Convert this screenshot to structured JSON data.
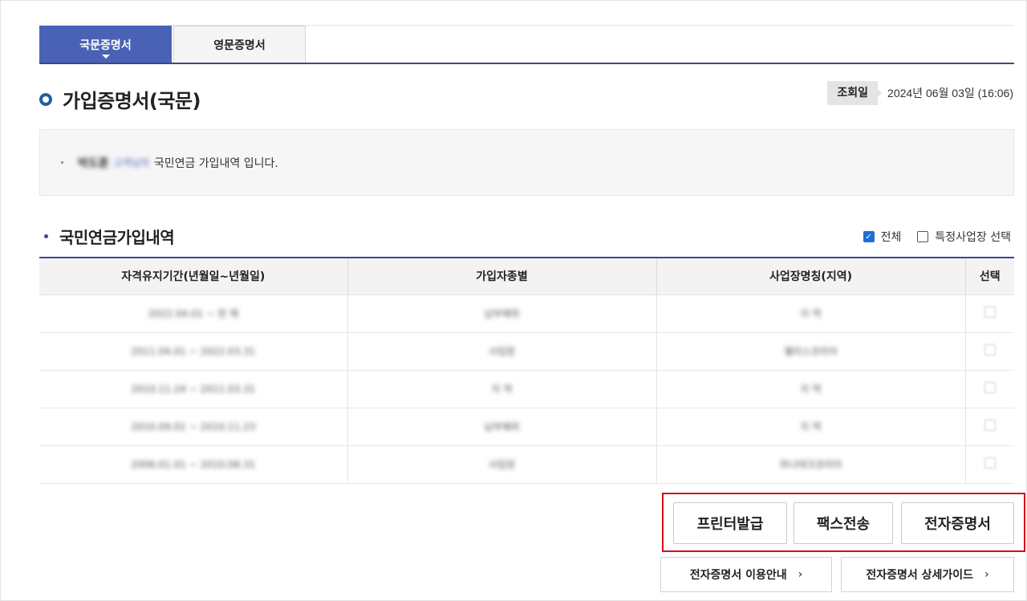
{
  "tabs": [
    {
      "label": "국문증명서",
      "active": true
    },
    {
      "label": "영문증명서",
      "active": false
    }
  ],
  "page_title": "가입증명서(국문)",
  "query": {
    "label": "조회일",
    "value": "2024년 06월 03일 (16:06)"
  },
  "info": {
    "name": "박도훈",
    "honorific": "고객님의",
    "message": "국민연금 가입내역 입니다."
  },
  "section": {
    "title": "국민연금가입내역",
    "filters": [
      {
        "label": "전체",
        "checked": true
      },
      {
        "label": "특정사업장 선택",
        "checked": false
      }
    ]
  },
  "table": {
    "headers": [
      "자격유지기간(년월일~년월일)",
      "가입자종별",
      "사업장명칭(지역)",
      "선택"
    ],
    "rows": [
      [
        "2022.04.01 ~ 현 재",
        "납부예외",
        "지 역"
      ],
      [
        "2011.04.01 ~ 2022.03.31",
        "사업장",
        "웰리스코리아"
      ],
      [
        "2010.11.24 ~ 2011.03.31",
        "지 역",
        "지 역"
      ],
      [
        "2010.09.01 ~ 2010.11.23",
        "납부예외",
        "지 역"
      ],
      [
        "2006.01.01 ~ 2010.08.31",
        "사업장",
        "하나테크코리아"
      ]
    ]
  },
  "buttons": {
    "print": "프린터발급",
    "fax": "팩스전송",
    "ecert": "전자증명서"
  },
  "guides": {
    "usage": "전자증명서 이용안내",
    "detail": "전자증명서 상세가이드"
  },
  "colors": {
    "accent": "#4a62b5",
    "navy": "#3b4a8c",
    "highlight": "#d3101b"
  }
}
